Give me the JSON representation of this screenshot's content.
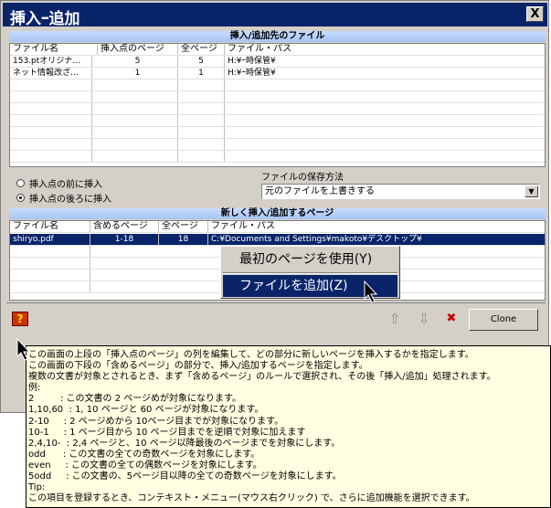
{
  "window": {
    "title": "挿入ｰ追加",
    "close_label": "X"
  },
  "top_section": {
    "title": "挿入/追加先のファイル",
    "columns": [
      "ファイル名",
      "挿入点のページ",
      "全ページ",
      "ファイル・パス"
    ],
    "rows": [
      [
        "153.ptオリジナ…",
        "5",
        "5",
        "H:¥ｰ時保管¥"
      ],
      [
        "ネット情報改ざ…",
        "1",
        "1",
        "H:¥ｰ時保管¥"
      ]
    ]
  },
  "insert_position": {
    "before_label": "挿入点の前に挿入",
    "after_label": "挿入点の後ろに挿入",
    "selected": "after"
  },
  "save_method": {
    "label": "ファイルの保存方法",
    "value": "元のファイルを上書きする",
    "arrow": "▼"
  },
  "bottom_section": {
    "title": "新しく挿入/追加するページ",
    "columns": [
      "ファイル名",
      "含めるページ",
      "全ページ",
      "ファイル・パス"
    ],
    "rows": [
      [
        "shiryo.pdf",
        "1-18",
        "18",
        "C:¥Documents and Settings¥makoto¥デスクトップ¥"
      ]
    ]
  },
  "context_menu": {
    "items": [
      "最初のページを使用(Y)",
      "ファイルを追加(Z)"
    ],
    "highlighted_index": 1
  },
  "toolbar": {
    "help_label": "?",
    "up_label": "⇧",
    "down_label": "⇩",
    "delete_label": "✖",
    "clone_label": "Clone"
  },
  "tooltip_lines": [
    "この画面の上段の「挿入点のページ」の列を編集して、どの部分に新しいページを挿入するかを指定します。",
    "この画面の下段の「含めるページ」の部分で、挿入/追加するページを指定します。",
    "複数の文書が対象とされるとき、まず「含めるページ」のルールで選択され、その後「挿入/追加」処理されます。",
    "例:",
    "2         : この文書の 2 ページめが対象になります。",
    "1,10,60  : 1, 10 ページと 60 ページが対象になります。",
    "2-10     : 2 ページめから 10ページ目までが対象になります。",
    "10-1     : 1 ページ目から 10 ページ目までを逆順で対象に加えます",
    "2,4,10-  : 2,4 ページと、10 ページ以降最後のページまでを対象にします。",
    "odd      : この文書の全ての奇数ページを対象にします。",
    "even     : この文書の全ての偶数ページを対象にします。",
    "5odd     : この文書の、5ページ目以降の全ての奇数ページを対象にします。",
    "Tip:",
    "この項目を登録するとき、コンテキスト・メニュー(マウス右クリック) で、さらに追加機能を選択できます。"
  ],
  "colors": {
    "title_bar": "#0a246a",
    "dialog_bg": "#d4d0c8",
    "tooltip_bg": "#ffffe1",
    "selection": "#0a246a",
    "section_bar": "#b8d0fa"
  }
}
